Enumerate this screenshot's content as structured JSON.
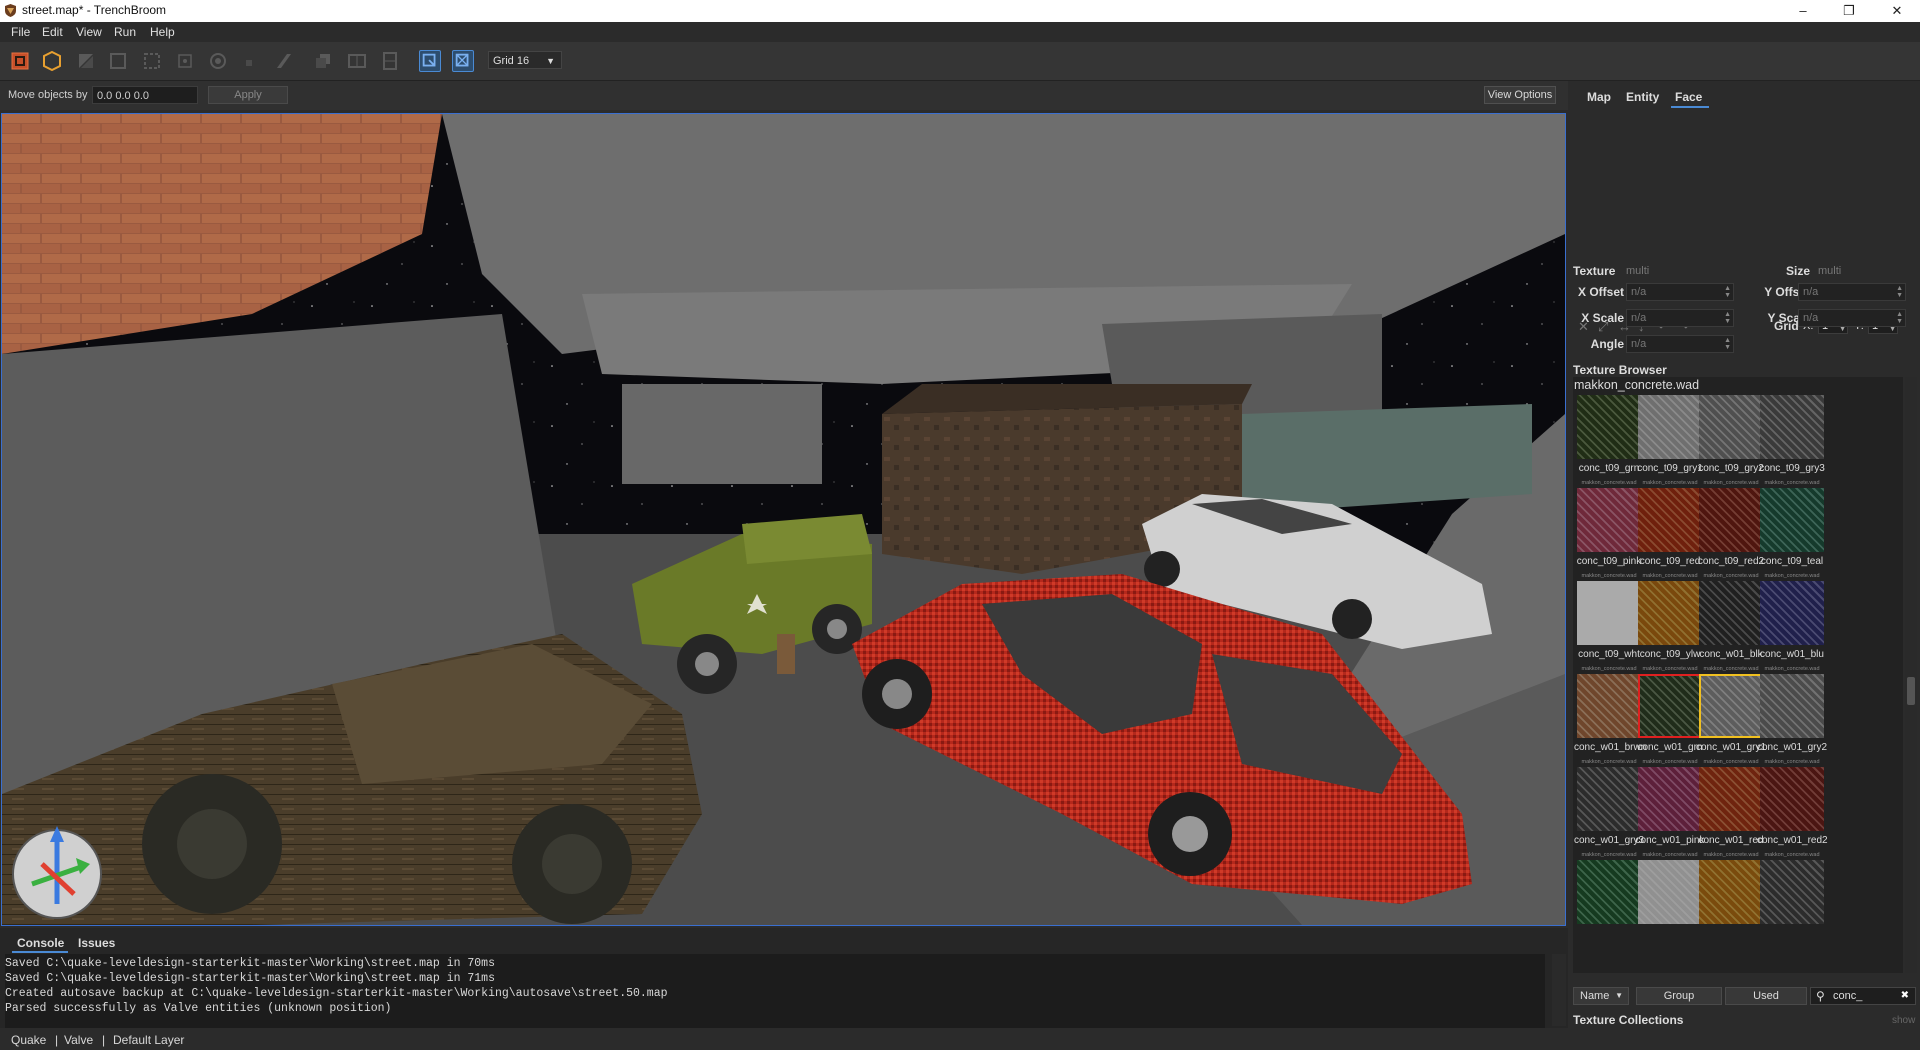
{
  "window": {
    "title": "street.map* - TrenchBroom",
    "minimize": "–",
    "maximize": "❐",
    "close": "✕"
  },
  "menu": [
    "File",
    "Edit",
    "View",
    "Run",
    "Help"
  ],
  "toolbar": {
    "grid_label": "Grid 16"
  },
  "movebar": {
    "label": "Move objects by",
    "value": "0.0 0.0 0.0",
    "apply": "Apply",
    "view_options": "View Options"
  },
  "inspector": {
    "tabs": [
      "Map",
      "Entity",
      "Face"
    ],
    "active_tab": "Face",
    "grid": {
      "label": "Grid",
      "x_label": "X:",
      "x_value": "1",
      "y_label": "Y:",
      "y_value": "1"
    },
    "texture_label": "Texture",
    "texture_value": "multi",
    "size_label": "Size",
    "size_value": "multi",
    "x_offset_label": "X Offset",
    "x_offset_value": "n/a",
    "y_offset_label": "Y Offset",
    "y_offset_value": "n/a",
    "x_scale_label": "X Scale",
    "x_scale_value": "n/a",
    "y_scale_label": "Y Scale",
    "y_scale_value": "n/a",
    "angle_label": "Angle",
    "angle_value": "n/a"
  },
  "texture_browser": {
    "title": "Texture Browser",
    "collection": "makkon_concrete.wad",
    "wad_label": "makkon_concrete.wad",
    "textures": [
      {
        "name": "conc_t09_grn",
        "color": "#5a6b4a",
        "selected": false
      },
      {
        "name": "conc_t09_gry1",
        "color": "#a8a8a8",
        "selected": false
      },
      {
        "name": "conc_t09_gry2",
        "color": "#8e8e8e",
        "selected": false
      },
      {
        "name": "conc_t09_gry3",
        "color": "#7a7a7a",
        "selected": false
      },
      {
        "name": "conc_t09_pink",
        "color": "#a8667a",
        "selected": false
      },
      {
        "name": "conc_t09_red",
        "color": "#a85a3a",
        "selected": false
      },
      {
        "name": "conc_t09_red2",
        "color": "#8e4a3e",
        "selected": false
      },
      {
        "name": "conc_t09_teal",
        "color": "#4a7a6a",
        "selected": false
      },
      {
        "name": "conc_t09_wht",
        "color": "#d0d0d0",
        "selected": false
      },
      {
        "name": "conc_t09_ylw",
        "color": "#b0883a",
        "selected": false
      },
      {
        "name": "conc_w01_blk",
        "color": "#5a5a5a",
        "selected": false
      },
      {
        "name": "conc_w01_blu",
        "color": "#5a5a8a",
        "selected": false
      },
      {
        "name": "conc_w01_brwn",
        "color": "#a8866a",
        "selected": false
      },
      {
        "name": "conc_w01_grn",
        "color": "#5a6a52",
        "selected": "red"
      },
      {
        "name": "conc_w01_gry1",
        "color": "#9a9a9a",
        "selected": "yellow"
      },
      {
        "name": "conc_w01_gry2",
        "color": "#8a8a8a",
        "selected": false
      },
      {
        "name": "conc_w01_gry3",
        "color": "#6a6a6a",
        "selected": false
      },
      {
        "name": "conc_w01_pink",
        "color": "#9a5a7a",
        "selected": false
      },
      {
        "name": "conc_w01_red",
        "color": "#a8603e",
        "selected": false
      },
      {
        "name": "conc_w01_red2",
        "color": "#8a4a44",
        "selected": false
      },
      {
        "name": "",
        "color": "#4a7a5a",
        "selected": false
      },
      {
        "name": "",
        "color": "#c0c0c0",
        "selected": false
      },
      {
        "name": "",
        "color": "#b08a3a",
        "selected": false
      },
      {
        "name": "",
        "color": "#6a6a6a",
        "selected": false
      }
    ],
    "sort_name": "Name",
    "sort_group": "Group",
    "sort_used": "Used",
    "search_value": "conc_",
    "collections_label": "Texture Collections",
    "show_label": "show"
  },
  "console": {
    "tabs": [
      "Console",
      "Issues"
    ],
    "lines": [
      "Saved C:\\quake-leveldesign-starterkit-master\\Working\\street.map in 70ms",
      "Saved C:\\quake-leveldesign-starterkit-master\\Working\\street.map in 71ms",
      "Created autosave backup at C:\\quake-leveldesign-starterkit-master\\Working\\autosave\\street.50.map",
      "Parsed successfully as Valve entities (unknown position)"
    ]
  },
  "statusbar": {
    "game": "Quake",
    "sep": "|",
    "format": "Valve",
    "layer": "Default Layer"
  },
  "colors": {
    "accent": "#4a8ad4",
    "viewport_border": "#3a6fd0"
  }
}
